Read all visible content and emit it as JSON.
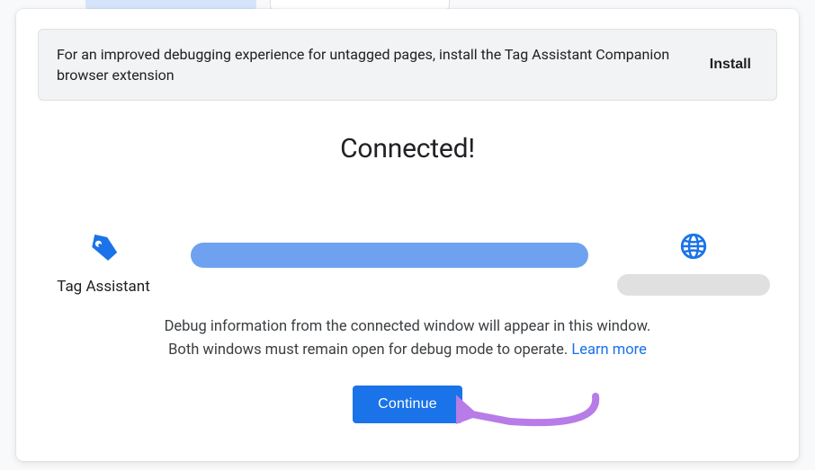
{
  "banner": {
    "text": "For an improved debugging experience for untagged pages, install the Tag Assistant Companion browser extension",
    "install_label": "Install"
  },
  "title": "Connected!",
  "endpoints": {
    "left_label": "Tag Assistant"
  },
  "description": {
    "line1": "Debug information from the connected window will appear in this window.",
    "line2": "Both windows must remain open for debug mode to operate. ",
    "learn_more": "Learn more"
  },
  "continue_label": "Continue",
  "colors": {
    "primary": "#1a73e8",
    "connection_bar": "#6ea1ef",
    "banner_bg": "#f1f3f4"
  }
}
